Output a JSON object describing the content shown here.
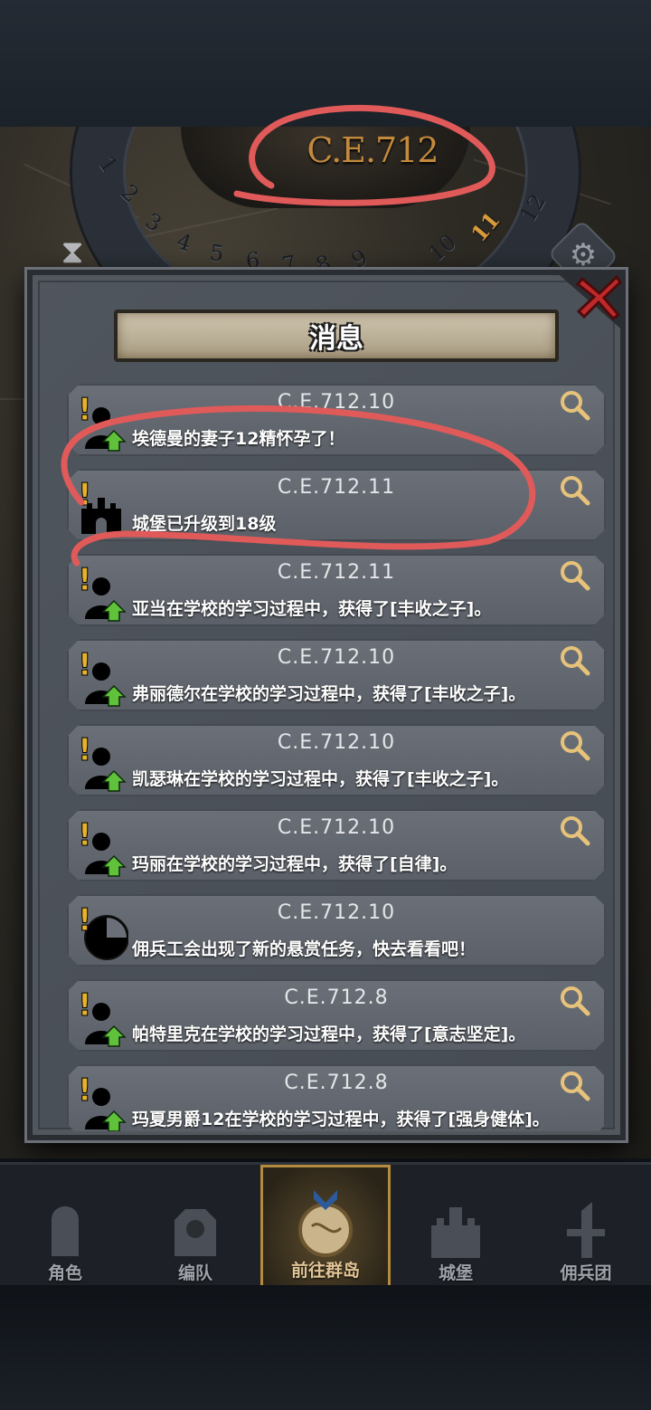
{
  "calendar": {
    "year": "C.E.712",
    "months": [
      "1",
      "2",
      "3",
      "4",
      "5",
      "6",
      "7",
      "8",
      "9",
      "10",
      "11",
      "12"
    ],
    "current_month": "11"
  },
  "dialog": {
    "title": "消息"
  },
  "messages": [
    {
      "date": "C.E.712.10",
      "text": "埃德曼的妻子12精怀孕了！",
      "icon": "person-up-icon",
      "searchable": true
    },
    {
      "date": "C.E.712.11",
      "text": "城堡已升级到18级",
      "icon": "castle-icon",
      "searchable": true
    },
    {
      "date": "C.E.712.11",
      "text": "亚当在学校的学习过程中，获得了[丰收之子]。",
      "icon": "person-up-icon",
      "searchable": true
    },
    {
      "date": "C.E.712.10",
      "text": "弗丽德尔在学校的学习过程中，获得了[丰收之子]。",
      "icon": "person-up-icon",
      "searchable": true
    },
    {
      "date": "C.E.712.10",
      "text": "凯瑟琳在学校的学习过程中，获得了[丰收之子]。",
      "icon": "person-up-icon",
      "searchable": true
    },
    {
      "date": "C.E.712.10",
      "text": "玛丽在学校的学习过程中，获得了[自律]。",
      "icon": "person-up-icon",
      "searchable": true
    },
    {
      "date": "C.E.712.10",
      "text": "佣兵工会出现了新的悬赏任务，快去看看吧！",
      "icon": "clock-icon",
      "searchable": false
    },
    {
      "date": "C.E.712.8",
      "text": "帕特里克在学校的学习过程中，获得了[意志坚定]。",
      "icon": "person-up-icon",
      "searchable": true
    },
    {
      "date": "C.E.712.8",
      "text": "玛夏男爵12在学校的学习过程中，获得了[强身健体]。",
      "icon": "person-up-icon",
      "searchable": true
    }
  ],
  "nav": [
    {
      "label": "角色",
      "icon": "knight-helmet-icon",
      "active": false
    },
    {
      "label": "编队",
      "icon": "armor-icon",
      "active": false
    },
    {
      "label": "前往群岛",
      "icon": "globe-icon",
      "active": true
    },
    {
      "label": "城堡",
      "icon": "castle-icon",
      "active": false
    },
    {
      "label": "佣兵团",
      "icon": "mercenary-icon",
      "active": false
    }
  ],
  "colors": {
    "accent": "#c48a3c",
    "annotation": "#e05a5a",
    "alert": "#e8b22a",
    "upgrade": "#5fc23a"
  }
}
